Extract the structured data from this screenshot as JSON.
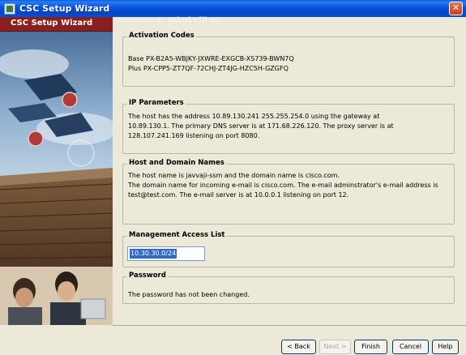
{
  "window": {
    "title": "CSC Setup Wizard",
    "close_glyph": "✕"
  },
  "sidebar": {
    "header": "CSC Setup Wizard"
  },
  "ghost_title": "Summary: Wind Lili St",
  "activation": {
    "title": "Activation Codes",
    "lines": [
      "Base PX-B2A5-WBJKY-JXWRE-EXGCB-XS739-BWN7Q",
      "Plus PX-CPP5-ZT7QF-72CHJ-ZT4JG-HZC5H-GZGFQ"
    ]
  },
  "ip": {
    "title": "IP Parameters",
    "lines": [
      "The host has the address 10.89.130.241 255.255.254.0 using the gateway at",
      "10.89.130.1. The primary DNS server is at 171.68.226.120. The proxy server is at",
      "128.107.241.169 listening on port 8080."
    ]
  },
  "host": {
    "title": "Host and Domain Names",
    "lines": [
      "The host name is javvaji-ssm and the domain name is cisco.com.",
      "The domain name for incoming e-mail is cisco.com. The e-mail adminstrator's e-mail address is",
      "test@test.com. The e-mail server is at 10.0.0.1 listening on port 12."
    ]
  },
  "mgmt": {
    "title": "Management Access List",
    "value": "10.30.30.0/24"
  },
  "password": {
    "title": "Password",
    "text": "The password has not been changed."
  },
  "buttons": {
    "back": "< Back",
    "next": "Next >",
    "finish": "Finish",
    "cancel": "Cancel",
    "help": "Help"
  }
}
